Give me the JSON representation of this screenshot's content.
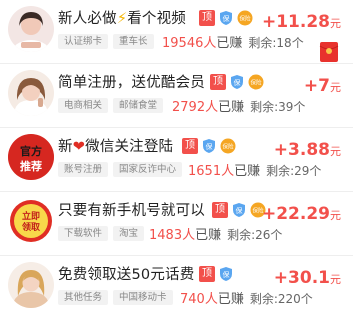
{
  "tasks": [
    {
      "title_a": "新人必做",
      "title_b": "看个视频",
      "badge_top": "顶",
      "badge_guarantee": "保",
      "badge_insurance": "保险",
      "reward_amount": "+11.28",
      "reward_unit": "元",
      "tags": [
        "认证绑卡",
        "重车长"
      ],
      "earned_count": "19546人",
      "earned_suffix": "已赚",
      "remaining": "剩余:18个"
    },
    {
      "title": "简单注册，送优酷会员",
      "badge_top": "顶",
      "badge_guarantee": "保",
      "badge_insurance": "保险",
      "reward_amount": "+7",
      "reward_unit": "元",
      "tags": [
        "电商相关",
        "邮储食堂"
      ],
      "earned_count": "2792人",
      "earned_suffix": "已赚",
      "remaining": "剩余:39个"
    },
    {
      "title_a": "新",
      "title_b": "微信关注登陆",
      "avatar_text_1": "官方",
      "avatar_text_2": "推荐",
      "badge_top": "顶",
      "badge_guarantee": "保",
      "badge_insurance": "保险",
      "reward_amount": "+3.88",
      "reward_unit": "元",
      "tags": [
        "账号注册",
        "国家反诈中心"
      ],
      "earned_count": "1651人",
      "earned_suffix": "已赚",
      "remaining": "剩余:29个"
    },
    {
      "title": "只要有新手机号就可以",
      "avatar_text_1": "立即",
      "avatar_text_2": "领取",
      "badge_top": "顶",
      "badge_guarantee": "保",
      "badge_insurance": "保险",
      "reward_amount": "+22.29",
      "reward_unit": "元",
      "tags": [
        "下载软件",
        "淘宝"
      ],
      "earned_count": "1483人",
      "earned_suffix": "已赚",
      "remaining": "剩余:26个"
    },
    {
      "title": "免费领取送50元话费",
      "badge_top": "顶",
      "badge_guarantee": "保",
      "reward_amount": "+30.1",
      "reward_unit": "元",
      "tags": [
        "其他任务",
        "中国移动卡"
      ],
      "earned_count": "740人",
      "earned_suffix": "已赚",
      "remaining": "剩余:220个"
    }
  ],
  "colors": {
    "accent_red": "#f2504b",
    "guarantee_blue": "#5aa6f0",
    "insurance_orange": "#f5a623"
  }
}
